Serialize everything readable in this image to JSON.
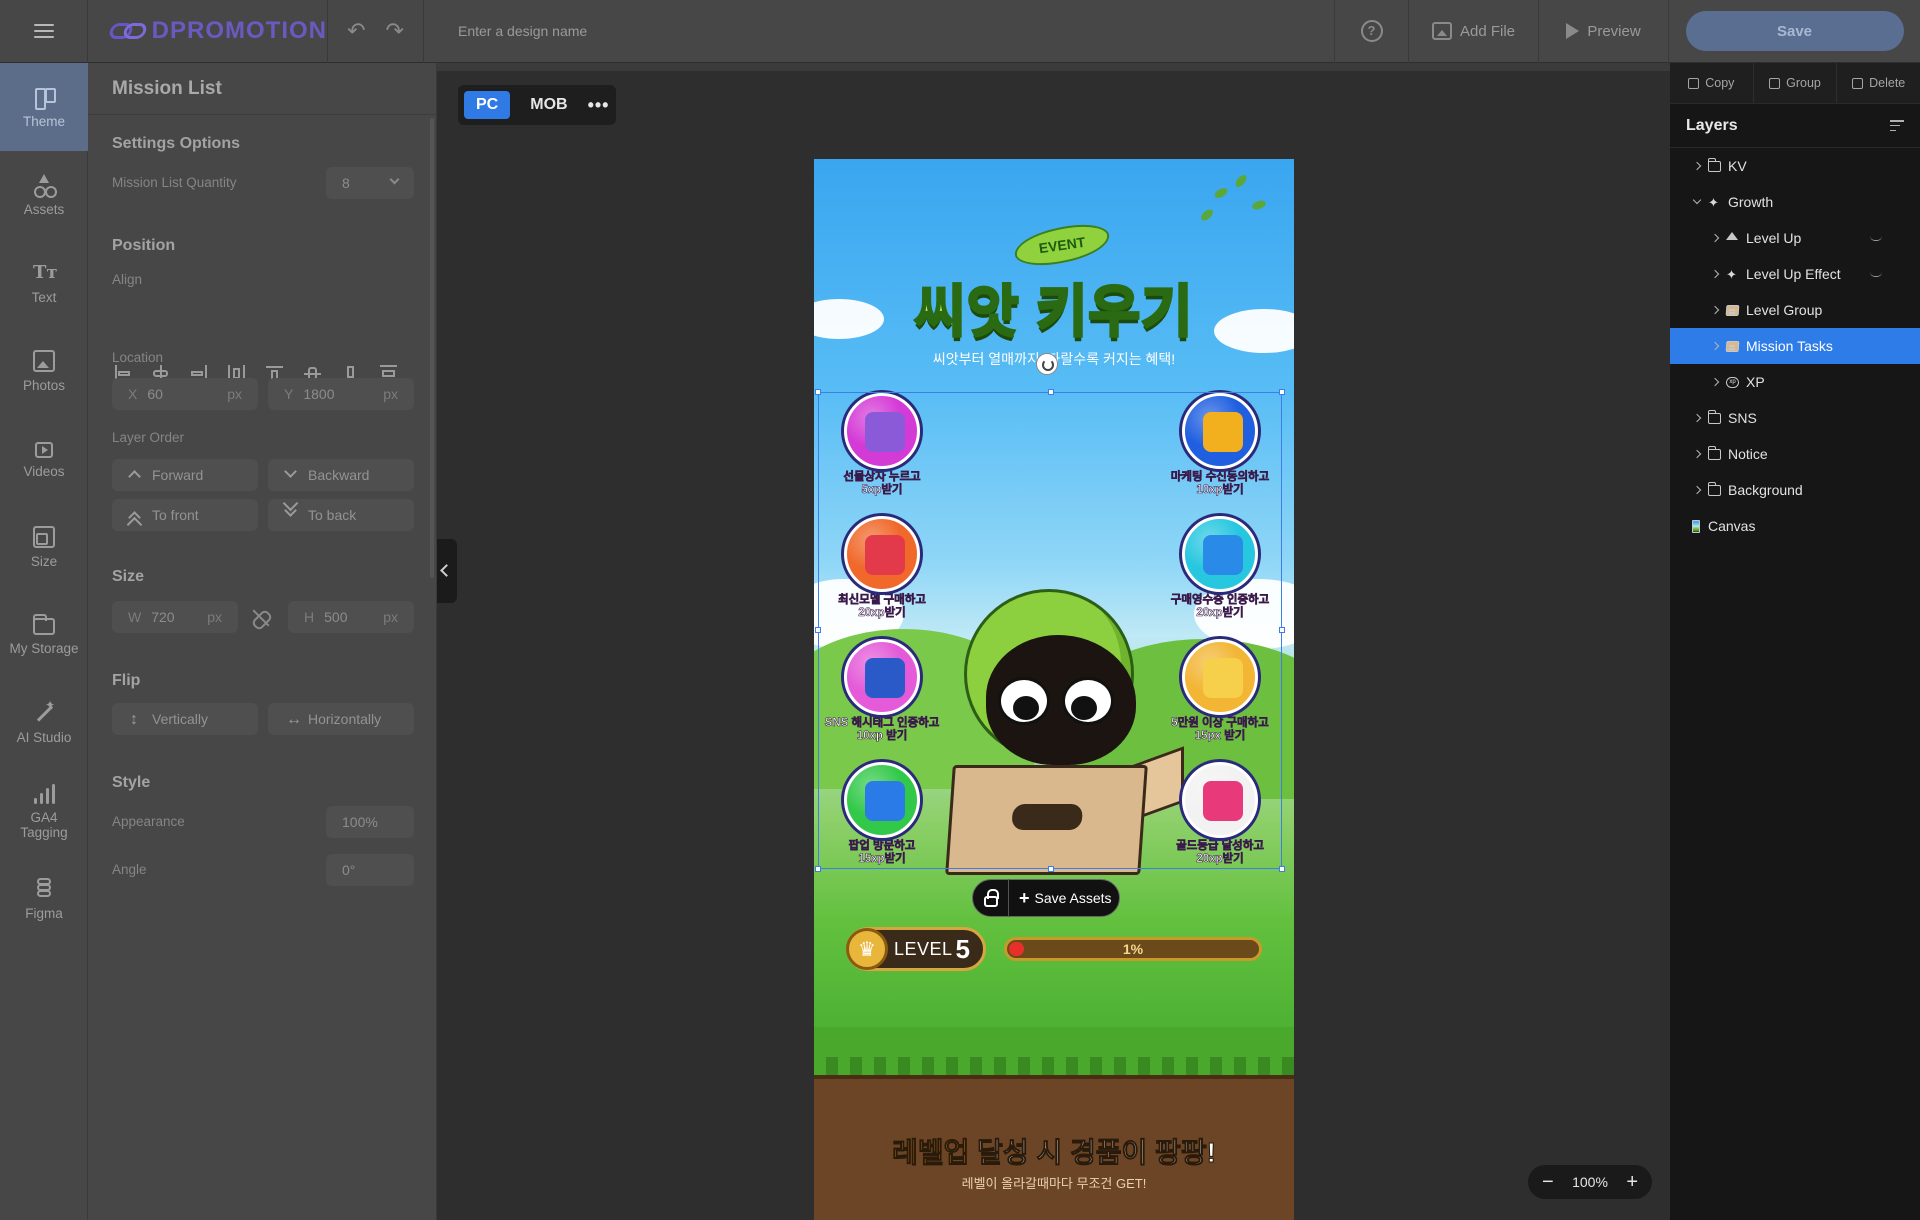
{
  "topbar": {
    "logo": "DPROMOTION",
    "undo": "↶",
    "redo": "↷",
    "design_name_placeholder": "Enter a design name",
    "help": "?",
    "add_file": "Add File",
    "preview": "Preview",
    "save": "Save"
  },
  "leftnav": [
    {
      "label": "Theme",
      "icon": "theme-icon",
      "active": true
    },
    {
      "label": "Assets",
      "icon": "assets-icon"
    },
    {
      "label": "Text",
      "icon": "text-icon"
    },
    {
      "label": "Photos",
      "icon": "photos-icon"
    },
    {
      "label": "Videos",
      "icon": "videos-icon"
    },
    {
      "label": "Size",
      "icon": "size-icon"
    },
    {
      "label": "My Storage",
      "icon": "storage-icon"
    },
    {
      "label": "AI Studio",
      "icon": "ai-studio-icon"
    },
    {
      "label": "GA4 Tagging",
      "icon": "ga4-icon"
    },
    {
      "label": "Figma",
      "icon": "figma-icon"
    }
  ],
  "settings": {
    "title": "Mission List",
    "options_title": "Settings Options",
    "quantity_label": "Mission List Quantity",
    "quantity_value": "8",
    "position_title": "Position",
    "align_label": "Align",
    "location_label": "Location",
    "x_label": "X",
    "x_value": "60",
    "y_label": "Y",
    "y_value": "1800",
    "unit": "px",
    "layer_order_label": "Layer Order",
    "forward": "Forward",
    "backward": "Backward",
    "to_front": "To front",
    "to_back": "To back",
    "size_title": "Size",
    "w_label": "W",
    "w_value": "720",
    "h_label": "H",
    "h_value": "500",
    "flip_title": "Flip",
    "vertically": "Vertically",
    "horizontally": "Horizontally",
    "style_title": "Style",
    "appearance_label": "Appearance",
    "appearance_value": "100%",
    "angle_label": "Angle",
    "angle_value": "0°"
  },
  "workspace": {
    "device_pc": "PC",
    "device_mob": "MOB",
    "device_more": "•••",
    "zoom_minus": "−",
    "zoom_value": "100%",
    "zoom_plus": "+"
  },
  "canvas": {
    "event_badge": "EVENT",
    "title": "씨앗 키우기",
    "subtitle": "씨앗부터 열매까지! 자랄수록 커지는 혜택!",
    "missions": [
      {
        "line1": "선물상자 누르고",
        "line2": "5xp받기",
        "color": "#d43ad6",
        "icon_color": "#8a5ad8"
      },
      {
        "line1": "마케팅 수신동의하고",
        "line2": "10xp받기",
        "color": "#1f5fe0",
        "icon_color": "#f2b01e"
      },
      {
        "line1": "최신모델 구매하고",
        "line2": "20xp받기",
        "color": "#f0682a",
        "icon_color": "#e23a4a"
      },
      {
        "line1": "구매영수증 인증하고",
        "line2": "20xp받기",
        "color": "#27c7e0",
        "icon_color": "#2a8ae8"
      },
      {
        "line1": "SNS 해시태그 인증하고",
        "line2": "10xp 받기",
        "color": "#e45ad8",
        "icon_color": "#2a5ac8"
      },
      {
        "line1": "5만원 이상 구매하고",
        "line2": "15px 받기",
        "color": "#f2b534",
        "icon_color": "#f6d04a"
      },
      {
        "line1": "팝업 방문하고",
        "line2": "15xp받기",
        "color": "#32c94a",
        "icon_color": "#2a7ae8"
      },
      {
        "line1": "골드등급 달성하고",
        "line2": "20xp받기",
        "color": "#f2f2f2",
        "icon_color": "#e83a7a"
      }
    ],
    "save_assets": "Save Assets",
    "save_assets_plus": "+",
    "level_word": "LEVEL",
    "level_number": "5",
    "progress_label": "1%",
    "progress_fraction": 0.06,
    "bottom_highlight": "레벨업",
    "bottom_title_rest": " 달성 시 경품이 팡팡!",
    "bottom_sub": "레벨이 올라갈때마다 무조건 GET!"
  },
  "rightpanel": {
    "copy": "Copy",
    "group": "Group",
    "delete": "Delete",
    "layers_title": "Layers",
    "layers": [
      {
        "label": "KV",
        "depth": 0,
        "icon": "folder",
        "expanded": false
      },
      {
        "label": "Growth",
        "depth": 0,
        "icon": "sparkle",
        "expanded": true
      },
      {
        "label": "Level Up",
        "depth": 1,
        "icon": "up",
        "hidden": true
      },
      {
        "label": "Level Up Effect",
        "depth": 1,
        "icon": "sparkle",
        "hidden": true
      },
      {
        "label": "Level Group",
        "depth": 1,
        "icon": "box"
      },
      {
        "label": "Mission Tasks",
        "depth": 1,
        "icon": "box",
        "active": true
      },
      {
        "label": "XP",
        "depth": 1,
        "icon": "round"
      },
      {
        "label": "SNS",
        "depth": 0,
        "icon": "folder"
      },
      {
        "label": "Notice",
        "depth": 0,
        "icon": "folder"
      },
      {
        "label": "Background",
        "depth": 0,
        "icon": "folder"
      },
      {
        "label": "Canvas",
        "depth": 0,
        "icon": "canvas",
        "nochev": true
      }
    ]
  },
  "colors": {
    "accent": "#2d7ce8",
    "save_button": "#5a6e91",
    "active_nav": "#5c6d8a",
    "selection": "#3d7ee8"
  }
}
